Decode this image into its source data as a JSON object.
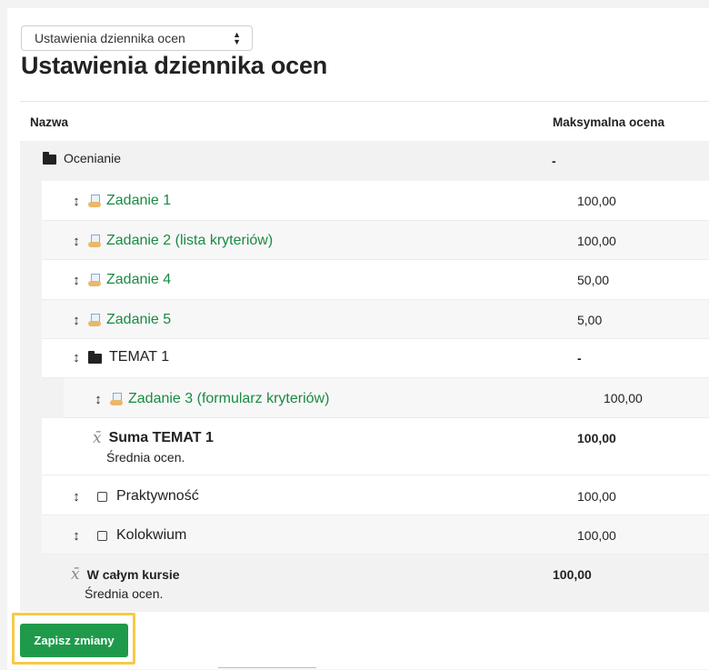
{
  "selector": {
    "value": "Ustawienia dziennika ocen"
  },
  "page_title": "Ustawienia dziennika ocen",
  "table": {
    "col_name": "Nazwa",
    "col_max": "Maksymalna ocena",
    "category": {
      "name": "Ocenianie",
      "max": "-"
    },
    "items": [
      {
        "name": "Zadanie 1",
        "max": "100,00"
      },
      {
        "name": "Zadanie 2 (lista kryteriów)",
        "max": "100,00"
      },
      {
        "name": "Zadanie 4",
        "max": "50,00"
      },
      {
        "name": "Zadanie 5",
        "max": "5,00"
      }
    ],
    "subcategory": {
      "name": "TEMAT 1",
      "max": "-"
    },
    "sub_item": {
      "name": "Zadanie 3 (formularz kryteriów)",
      "max": "100,00"
    },
    "sub_total": {
      "name": "Suma TEMAT 1",
      "note": "Średnia ocen.",
      "max": "100,00"
    },
    "manual_items": [
      {
        "name": "Praktywność",
        "max": "100,00"
      },
      {
        "name": "Kolokwium",
        "max": "100,00"
      }
    ],
    "course_total": {
      "name": "W całym kursie",
      "note": "Średnia ocen.",
      "max": "100,00"
    }
  },
  "save_button": "Zapisz zmiany"
}
